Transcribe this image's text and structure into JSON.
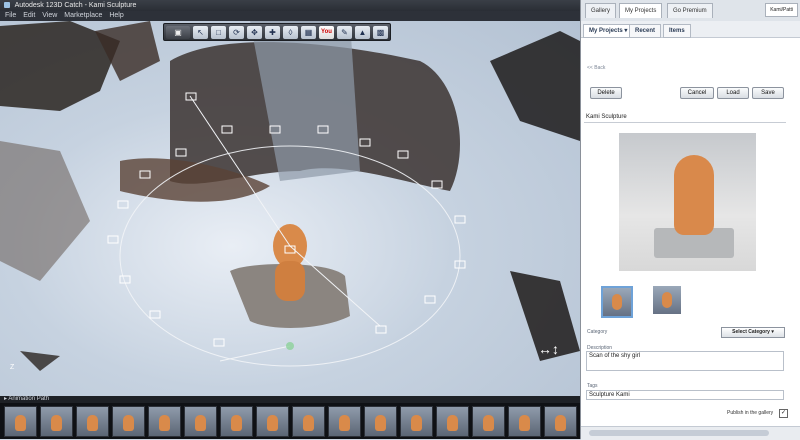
{
  "window": {
    "title": "Autodesk 123D Catch - Kami Sculpture"
  },
  "menu": [
    "File",
    "Edit",
    "View",
    "Marketplace",
    "Help"
  ],
  "toolbar": {
    "youtube_label": "You"
  },
  "viewport": {
    "axis_label": "Z"
  },
  "filmstrip": {
    "label": "Animation Path"
  },
  "panel": {
    "tabs": [
      "Gallery",
      "My Projects",
      "Go Premium"
    ],
    "user_button": "Kami/Patti",
    "subtabs": [
      "My Projects",
      "Recent",
      "Items"
    ],
    "back_link": "<< Back",
    "buttons": {
      "delete": "Delete",
      "cancel": "Cancel",
      "load": "Load",
      "save": "Save"
    },
    "project_title": "Kami Sculpture",
    "category_label": "Category",
    "category_select": "Select Category",
    "description_label": "Description",
    "description_value": "Scan of the shy girl",
    "tags_label": "Tags",
    "tags_value": "Sculpture Kami",
    "publish_label": "Publish in the gallery",
    "publish_checked": true
  }
}
